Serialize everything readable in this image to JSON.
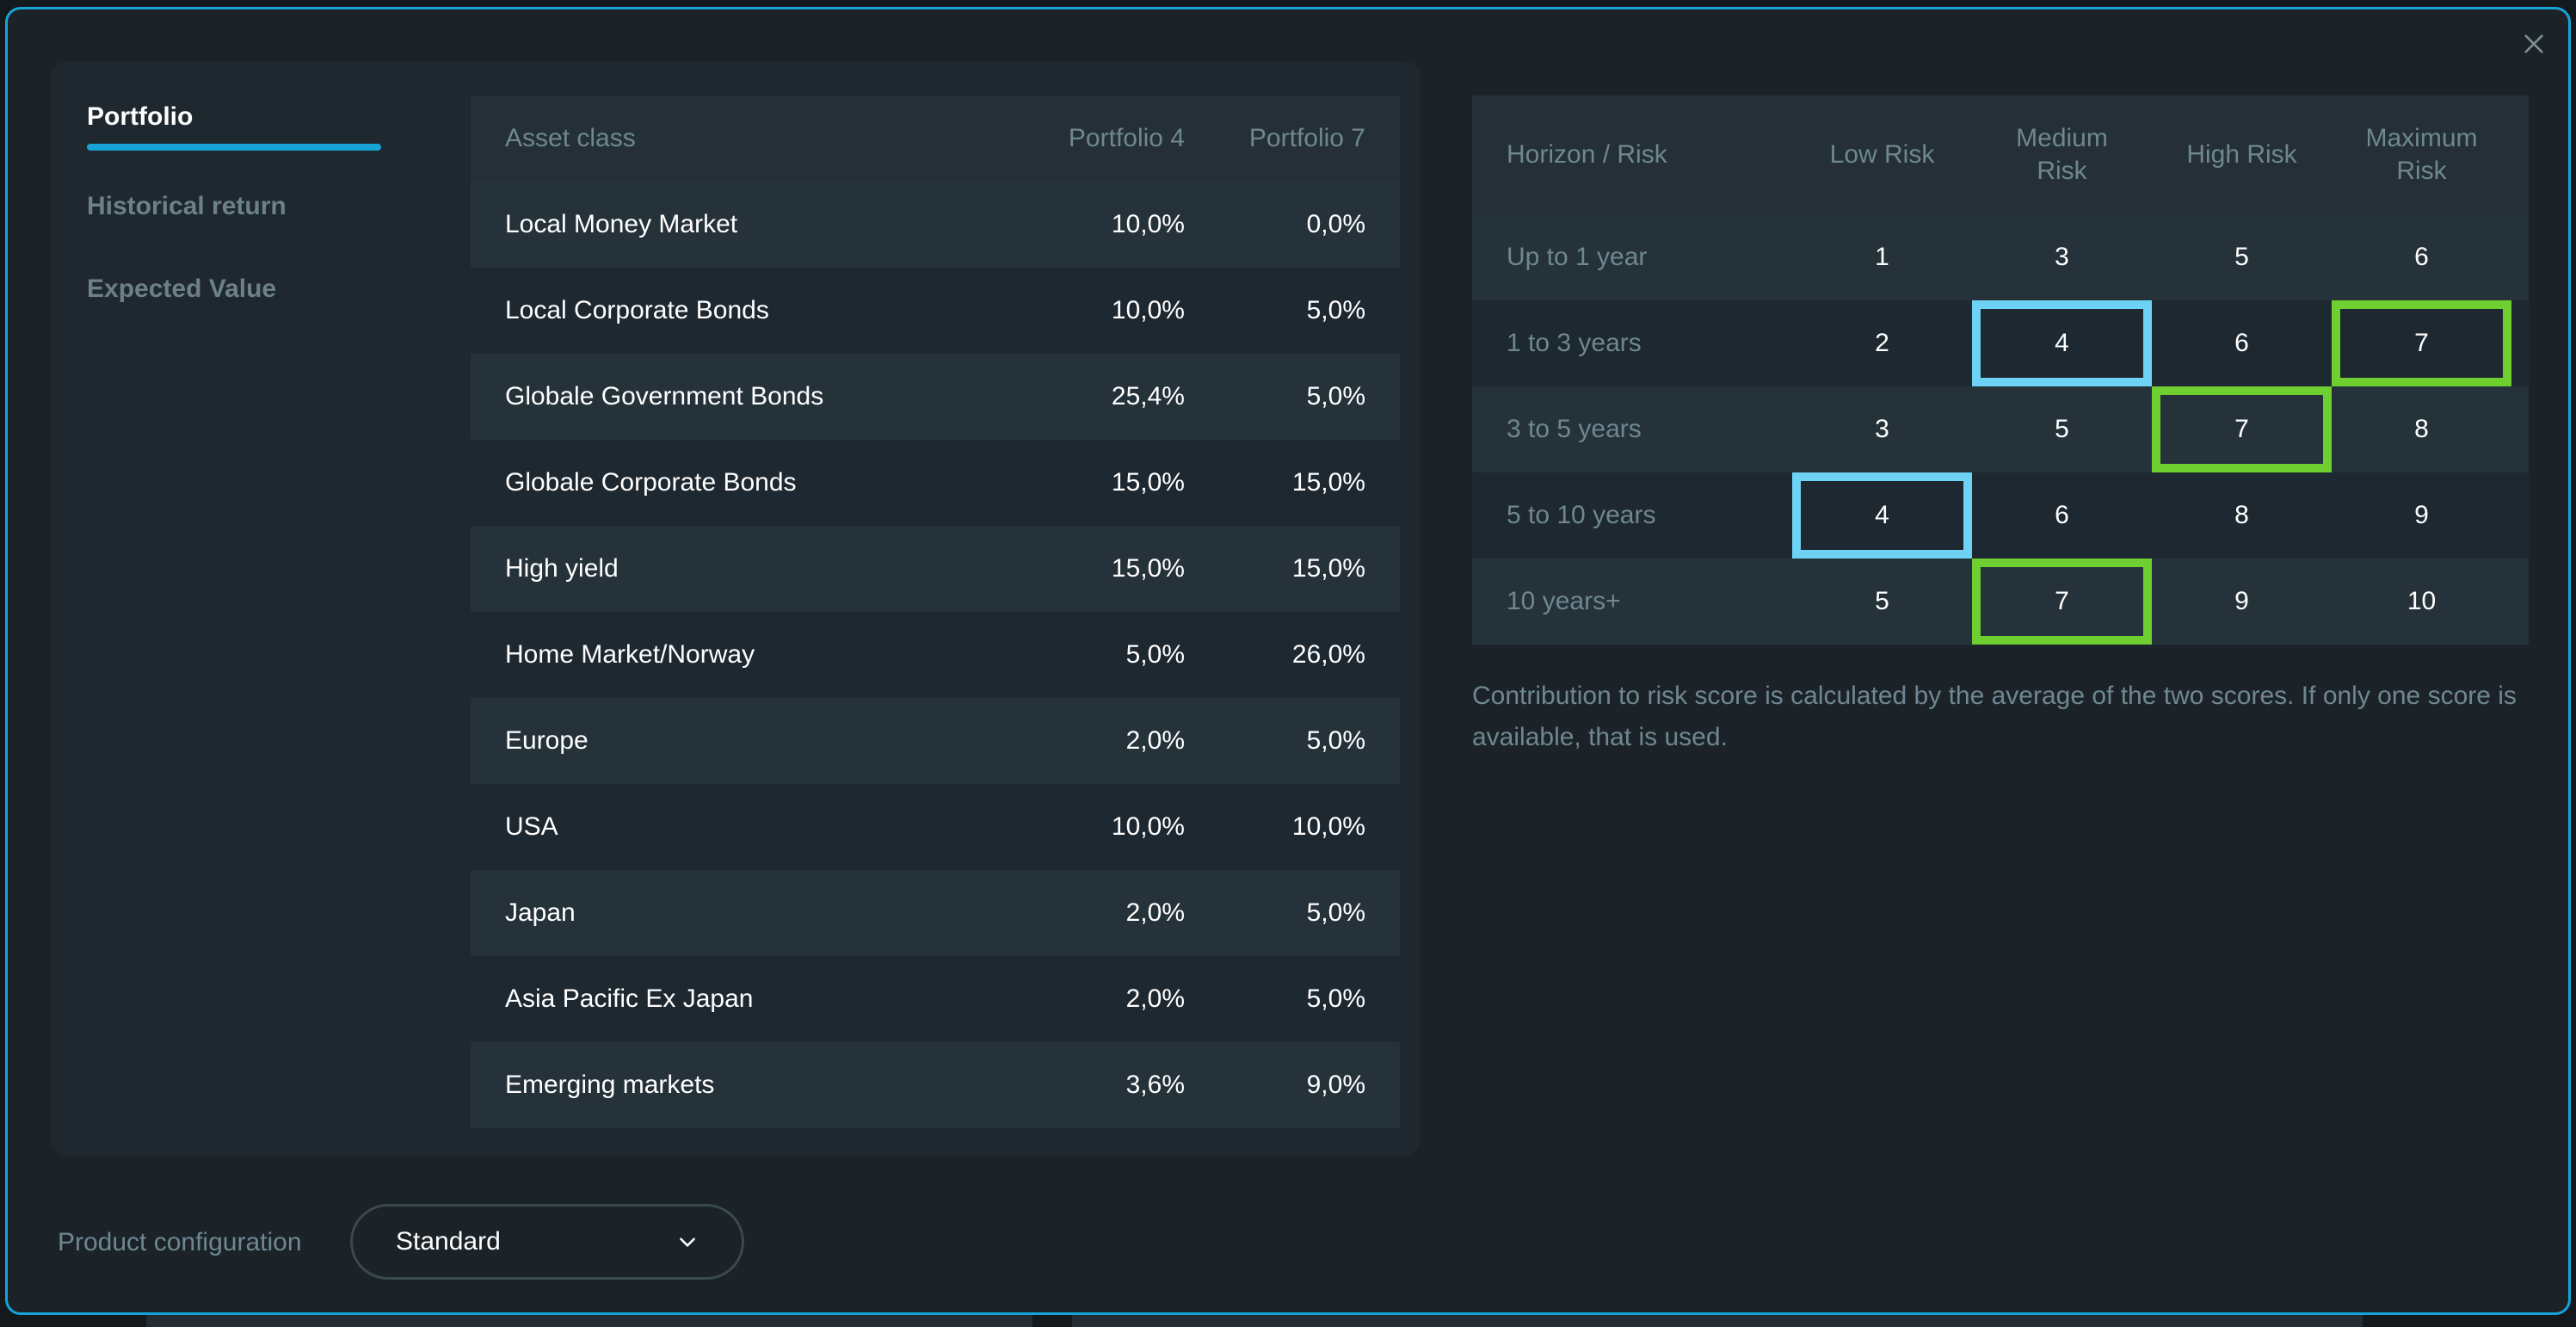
{
  "tabs": [
    {
      "label": "Portfolio",
      "active": true
    },
    {
      "label": "Historical return",
      "active": false
    },
    {
      "label": "Expected Value",
      "active": false
    }
  ],
  "asset_table": {
    "headers": [
      "Asset class",
      "Portfolio 4",
      "Portfolio 7"
    ],
    "rows": [
      [
        "Local Money Market",
        "10,0%",
        "0,0%"
      ],
      [
        "Local Corporate Bonds",
        "10,0%",
        "5,0%"
      ],
      [
        "Globale Government Bonds",
        "25,4%",
        "5,0%"
      ],
      [
        "Globale Corporate Bonds",
        "15,0%",
        "15,0%"
      ],
      [
        "High yield",
        "15,0%",
        "15,0%"
      ],
      [
        "Home Market/Norway",
        "5,0%",
        "26,0%"
      ],
      [
        "Europe",
        "2,0%",
        "5,0%"
      ],
      [
        "USA",
        "10,0%",
        "10,0%"
      ],
      [
        "Japan",
        "2,0%",
        "5,0%"
      ],
      [
        "Asia Pacific Ex Japan",
        "2,0%",
        "5,0%"
      ],
      [
        "Emerging markets",
        "3,6%",
        "9,0%"
      ]
    ]
  },
  "risk_table": {
    "headers": [
      "Horizon / Risk",
      "Low Risk",
      "Medium\nRisk",
      "High Risk",
      "Maximum\nRisk"
    ],
    "rows": [
      {
        "label": "Up to 1 year",
        "values": [
          "1",
          "3",
          "5",
          "6"
        ],
        "highlights": [
          "",
          "",
          "",
          ""
        ]
      },
      {
        "label": "1 to 3 years",
        "values": [
          "2",
          "4",
          "6",
          "7"
        ],
        "highlights": [
          "",
          "blue",
          "",
          "green"
        ]
      },
      {
        "label": "3 to 5 years",
        "values": [
          "3",
          "5",
          "7",
          "8"
        ],
        "highlights": [
          "",
          "",
          "green",
          ""
        ]
      },
      {
        "label": "5 to 10 years",
        "values": [
          "4",
          "6",
          "8",
          "9"
        ],
        "highlights": [
          "blue",
          "",
          "",
          ""
        ]
      },
      {
        "label": "10 years+",
        "values": [
          "5",
          "7",
          "9",
          "10"
        ],
        "highlights": [
          "",
          "green",
          "",
          ""
        ]
      }
    ],
    "highlight_colors": {
      "blue": "#6dd2f3",
      "green": "#6fce30"
    }
  },
  "note": "Contribution to risk score is calculated by the average of the two scores. If only one score is available, that is used.",
  "footer": {
    "label": "Product configuration",
    "select_value": "Standard"
  },
  "icons": {
    "close": "close-icon",
    "dropdown": "chevron-down-icon"
  },
  "colors": {
    "accent": "#17a3d6",
    "background": "#1b2329",
    "panel": "#1e282e"
  }
}
